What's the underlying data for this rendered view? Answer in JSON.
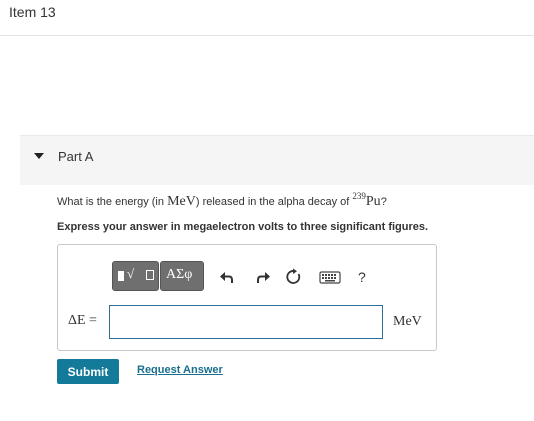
{
  "item": {
    "title": "Item 13"
  },
  "part": {
    "label": "Part A"
  },
  "question": {
    "prefix": "What is the energy (in ",
    "unit": "MeV",
    "middle": ") released in the alpha decay of ",
    "mass_number": "239",
    "element": "Pu",
    "suffix": "?"
  },
  "instruction": "Express your answer in megaelectron volts to three significant figures.",
  "toolbar": {
    "templates_glyph": "√",
    "symbols_label": "ΑΣφ",
    "help_label": "?"
  },
  "answer": {
    "label": "ΔE =",
    "value": "",
    "placeholder": "",
    "unit": "MeV"
  },
  "actions": {
    "submit_label": "Submit",
    "request_label": "Request Answer"
  },
  "colors": {
    "submit_bg": "#147a99",
    "link": "#1a6f8f",
    "input_border": "#2c6f98",
    "toolbar_bg": "#6f6f6f"
  }
}
